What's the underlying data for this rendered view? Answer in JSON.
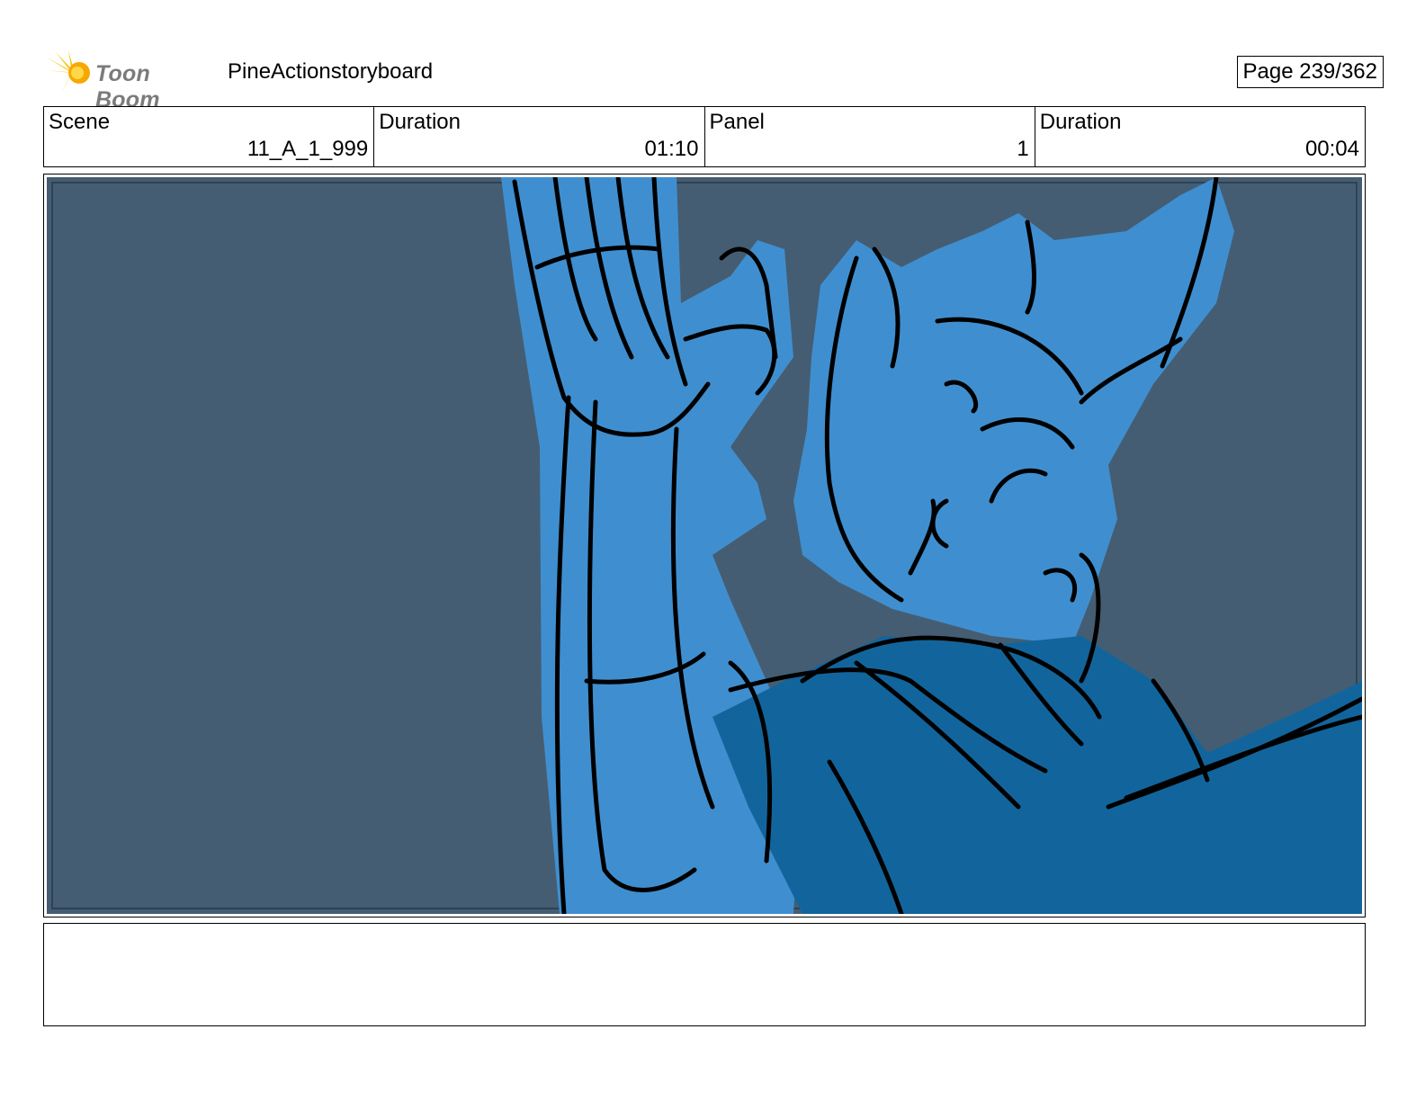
{
  "header": {
    "logo_text": "Toon Boom",
    "project_title": "PineActionstoryboard",
    "page_label": "Page 239/362"
  },
  "info": {
    "scene_label": "Scene",
    "scene_value": "11_A_1_999",
    "scene_duration_label": "Duration",
    "scene_duration_value": "01:10",
    "panel_label": "Panel",
    "panel_value": "1",
    "panel_duration_label": "Duration",
    "panel_duration_value": "00:04"
  },
  "panel": {
    "background_color": "#455d72",
    "fill_light": "#3f8fd0",
    "fill_dark": "#12659c",
    "line_color": "#000000"
  },
  "notes": {
    "text": ""
  }
}
